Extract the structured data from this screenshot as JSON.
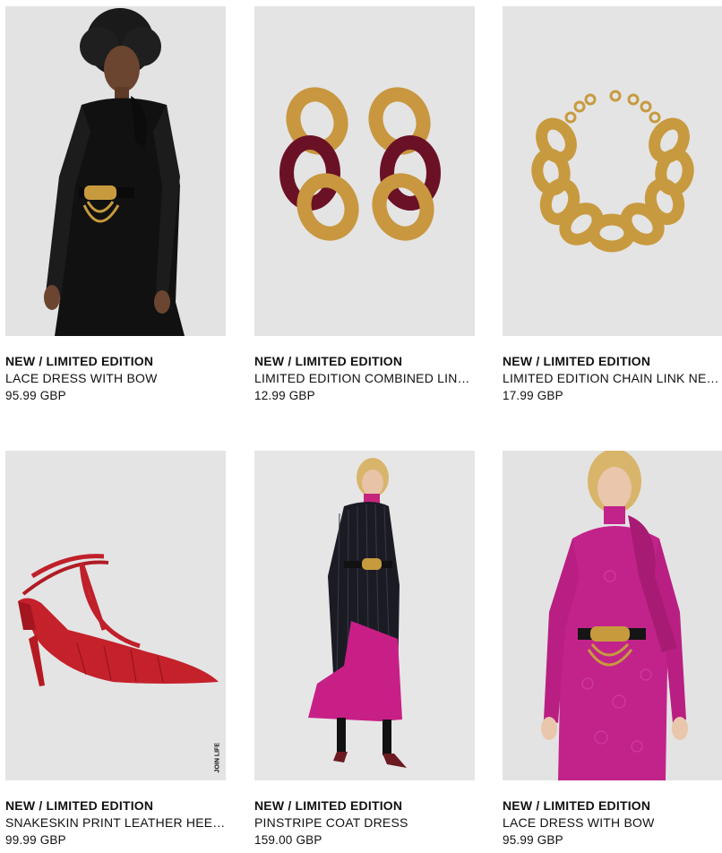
{
  "products": [
    {
      "badge": "NEW / LIMITED EDITION",
      "name": "LACE DRESS WITH BOW",
      "price": "95.99 GBP",
      "image": "model-black-lace-dress"
    },
    {
      "badge": "NEW / LIMITED EDITION",
      "name": "LIMITED EDITION COMBINED LINK EARRINGS",
      "price": "12.99 GBP",
      "image": "gold-burgundy-chain-earrings"
    },
    {
      "badge": "NEW / LIMITED EDITION",
      "name": "LIMITED EDITION CHAIN LINK NECKLACE",
      "price": "17.99 GBP",
      "image": "gold-chain-necklace"
    },
    {
      "badge": "NEW / LIMITED EDITION",
      "name": "SNAKESKIN PRINT LEATHER HEELS",
      "price": "99.99 GBP",
      "image": "red-snakeskin-heel",
      "stamp": "JOIN LIFE"
    },
    {
      "badge": "NEW / LIMITED EDITION",
      "name": "PINSTRIPE COAT DRESS",
      "price": "159.00 GBP",
      "image": "model-pinstripe-coat"
    },
    {
      "badge": "NEW / LIMITED EDITION",
      "name": "LACE DRESS WITH BOW",
      "price": "95.99 GBP",
      "image": "model-pink-lace-dress"
    }
  ],
  "colors": {
    "image_bg": "#e4e4e4",
    "text": "#111111"
  }
}
